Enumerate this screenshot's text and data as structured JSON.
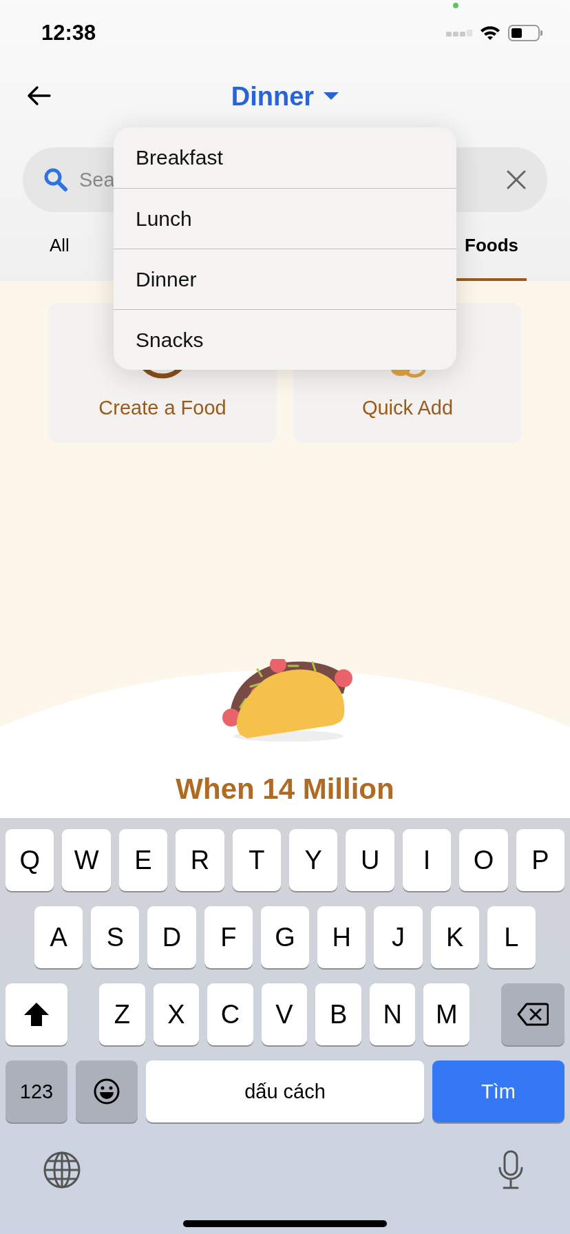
{
  "status_bar": {
    "time": "12:38"
  },
  "header": {
    "title": "Dinner"
  },
  "search": {
    "placeholder": "Sea"
  },
  "tabs": [
    {
      "label": "All",
      "selected": false
    },
    {
      "label": "Foods",
      "selected": true
    }
  ],
  "meal_menu": [
    {
      "label": "Breakfast"
    },
    {
      "label": "Lunch"
    },
    {
      "label": "Dinner"
    },
    {
      "label": "Snacks"
    }
  ],
  "cards": [
    {
      "label": "Create a Food"
    },
    {
      "label": "Quick Add"
    }
  ],
  "heading": "When 14 Million",
  "keyboard": {
    "rows": [
      {
        "keys": [
          {
            "kind": "letter",
            "label": "Q"
          },
          {
            "kind": "letter",
            "label": "W"
          },
          {
            "kind": "letter",
            "label": "E"
          },
          {
            "kind": "letter",
            "label": "R"
          },
          {
            "kind": "letter",
            "label": "T"
          },
          {
            "kind": "letter",
            "label": "Y"
          },
          {
            "kind": "letter",
            "label": "U"
          },
          {
            "kind": "letter",
            "label": "I"
          },
          {
            "kind": "letter",
            "label": "O"
          },
          {
            "kind": "letter",
            "label": "P"
          }
        ]
      },
      {
        "keys": [
          {
            "kind": "letter",
            "label": "A"
          },
          {
            "kind": "letter",
            "label": "S"
          },
          {
            "kind": "letter",
            "label": "D"
          },
          {
            "kind": "letter",
            "label": "F"
          },
          {
            "kind": "letter",
            "label": "G"
          },
          {
            "kind": "letter",
            "label": "H"
          },
          {
            "kind": "letter",
            "label": "J"
          },
          {
            "kind": "letter",
            "label": "K"
          },
          {
            "kind": "letter",
            "label": "L"
          }
        ]
      },
      {
        "keys": [
          {
            "kind": "shift"
          },
          {
            "kind": "letter",
            "label": "Z"
          },
          {
            "kind": "letter",
            "label": "X"
          },
          {
            "kind": "letter",
            "label": "C"
          },
          {
            "kind": "letter",
            "label": "V"
          },
          {
            "kind": "letter",
            "label": "B"
          },
          {
            "kind": "letter",
            "label": "N"
          },
          {
            "kind": "letter",
            "label": "M"
          },
          {
            "kind": "delete"
          }
        ]
      },
      {
        "keys": [
          {
            "kind": "numbers",
            "label": "123"
          },
          {
            "kind": "emoji"
          },
          {
            "kind": "space",
            "label": "dấu cách"
          },
          {
            "kind": "action",
            "label": "Tìm"
          }
        ]
      }
    ]
  }
}
